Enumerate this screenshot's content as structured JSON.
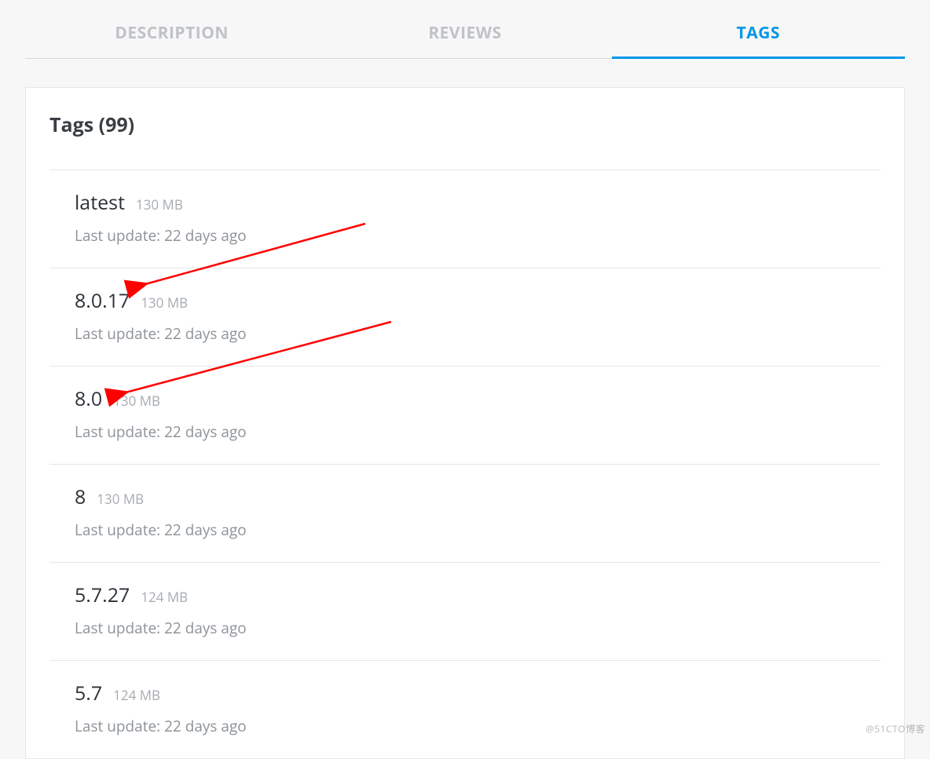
{
  "tabs": {
    "description": "DESCRIPTION",
    "reviews": "REVIEWS",
    "tags": "TAGS"
  },
  "card": {
    "title": "Tags (99)"
  },
  "tags": [
    {
      "name": "latest",
      "size": "130 MB",
      "update": "Last update: 22 days ago"
    },
    {
      "name": "8.0.17",
      "size": "130 MB",
      "update": "Last update: 22 days ago"
    },
    {
      "name": "8.0",
      "size": "130 MB",
      "update": "Last update: 22 days ago"
    },
    {
      "name": "8",
      "size": "130 MB",
      "update": "Last update: 22 days ago"
    },
    {
      "name": "5.7.27",
      "size": "124 MB",
      "update": "Last update: 22 days ago"
    },
    {
      "name": "5.7",
      "size": "124 MB",
      "update": "Last update: 22 days ago"
    }
  ],
  "watermark": "@51CTO博客"
}
